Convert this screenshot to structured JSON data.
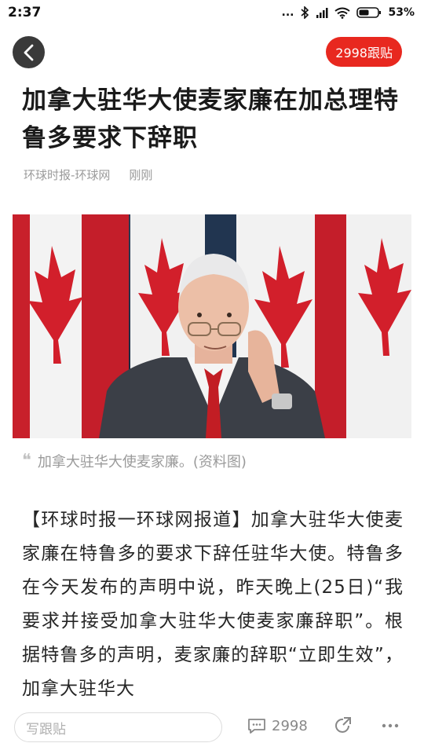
{
  "status": {
    "time": "2:37",
    "dots": "...",
    "battery": "53%"
  },
  "header": {
    "comment_badge": "2998跟贴"
  },
  "article": {
    "title": "加拿大驻华大使麦家廉在加总理特鲁多要求下辞职",
    "source": "环球时报-环球网",
    "time": "刚刚",
    "caption": "加拿大驻华大使麦家廉。(资料图)",
    "body": "【环球时报一环球网报道】加拿大驻华大使麦家廉在特鲁多的要求下辞任驻华大使。特鲁多在今天发布的声明中说，昨天晚上(25日)“我要求并接受加拿大驻华大使麦家廉辞职”。根据特鲁多的声明，麦家廉的辞职“立即生效”，加拿大驻华大"
  },
  "bottom": {
    "reply_placeholder": "写跟贴",
    "comment_count": "2998"
  },
  "colors": {
    "accent": "#e8281f",
    "back_button": "#3a3a3a"
  },
  "icons": [
    "back-arrow-icon",
    "bluetooth-icon",
    "signal-icon",
    "wifi-icon",
    "battery-icon",
    "quote-icon",
    "comment-icon",
    "share-icon",
    "more-icon"
  ]
}
